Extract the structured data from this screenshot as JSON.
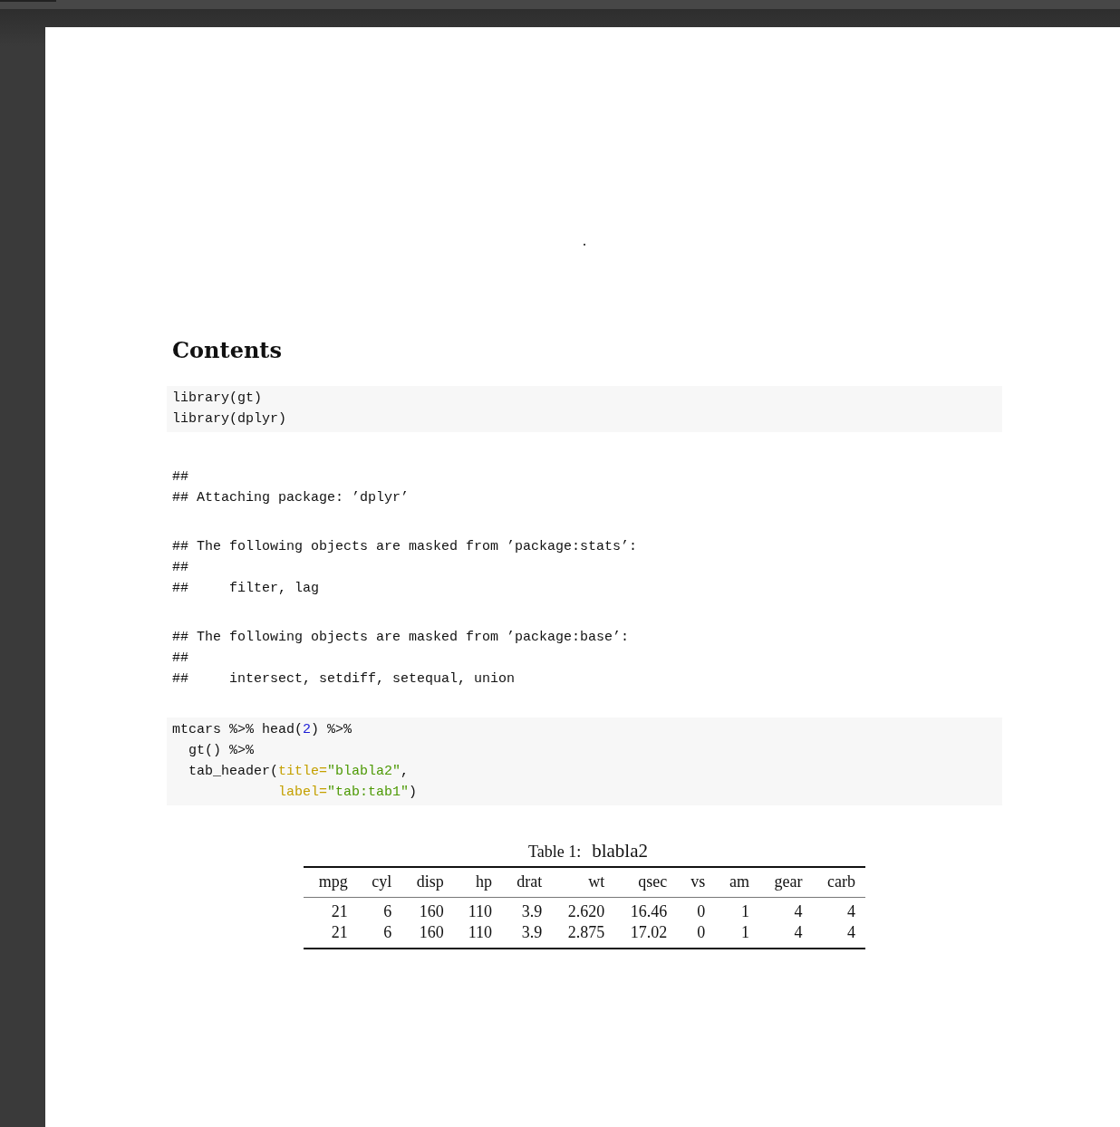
{
  "page": {
    "mark": ".",
    "heading": "Contents",
    "blocks": [
      {
        "kind": "code",
        "lines": [
          [
            {
              "kind": "plain",
              "text": "library(gt)"
            }
          ],
          [
            {
              "kind": "plain",
              "text": "library(dplyr)"
            }
          ]
        ]
      },
      {
        "kind": "output",
        "lines": [
          "##",
          "## Attaching package: ’dplyr’"
        ]
      },
      {
        "kind": "output",
        "lines": [
          "## The following objects are masked from ’package:stats’:",
          "##",
          "##     filter, lag"
        ]
      },
      {
        "kind": "output",
        "lines": [
          "## The following objects are masked from ’package:base’:",
          "##",
          "##     intersect, setdiff, setequal, union"
        ]
      },
      {
        "kind": "code",
        "lines": [
          [
            {
              "kind": "plain",
              "text": "mtcars %>% head("
            },
            {
              "kind": "number",
              "text": "2"
            },
            {
              "kind": "plain",
              "text": ") %>%"
            }
          ],
          [
            {
              "kind": "plain",
              "text": "  gt() %>%"
            }
          ],
          [
            {
              "kind": "plain",
              "text": "  tab_header("
            },
            {
              "kind": "arg",
              "text": "title="
            },
            {
              "kind": "string",
              "text": "\"blabla2\""
            },
            {
              "kind": "plain",
              "text": ","
            }
          ],
          [
            {
              "kind": "arg",
              "text": "             label="
            },
            {
              "kind": "string",
              "text": "\"tab:tab1\""
            },
            {
              "kind": "plain",
              "text": ")"
            }
          ]
        ]
      }
    ],
    "table": {
      "caption_label": "Table 1:",
      "caption_title": "blabla2",
      "columns": [
        "mpg",
        "cyl",
        "disp",
        "hp",
        "drat",
        "wt",
        "qsec",
        "vs",
        "am",
        "gear",
        "carb"
      ],
      "rows": [
        [
          "21",
          "6",
          "160",
          "110",
          "3.9",
          "2.620",
          "16.46",
          "0",
          "1",
          "4",
          "4"
        ],
        [
          "21",
          "6",
          "160",
          "110",
          "3.9",
          "2.875",
          "17.02",
          "0",
          "1",
          "4",
          "4"
        ]
      ]
    }
  }
}
